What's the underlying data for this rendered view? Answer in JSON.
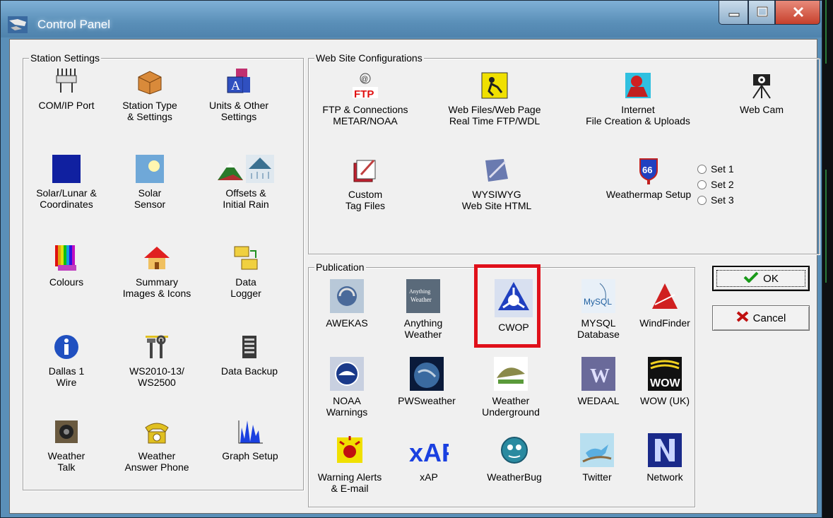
{
  "window": {
    "title": "Control Panel"
  },
  "station_settings": {
    "legend": "Station Settings",
    "items": [
      {
        "label": "COM/IP Port",
        "icon": "port-icon"
      },
      {
        "label": "Station Type\n& Settings",
        "icon": "box-icon"
      },
      {
        "label": "Units & Other\nSettings",
        "icon": "abc-blocks-icon"
      },
      {
        "label": "Solar/Lunar &\nCoordinates",
        "icon": "moon-icon"
      },
      {
        "label": "Solar\nSensor",
        "icon": "sun-icon"
      },
      {
        "label": "Offsets &\nInitial Rain",
        "icon": "mountain-rain-icon"
      },
      {
        "label": "Colours",
        "icon": "colours-icon"
      },
      {
        "label": "Summary\nImages & Icons",
        "icon": "house-icon"
      },
      {
        "label": "Data\nLogger",
        "icon": "folders-icon"
      },
      {
        "label": "Dallas 1\nWire",
        "icon": "info-icon"
      },
      {
        "label": "WS2010-13/\nWS2500",
        "icon": "tools-icon"
      },
      {
        "label": "Data Backup",
        "icon": "vise-icon"
      },
      {
        "label": "Weather\nTalk",
        "icon": "speaker-icon"
      },
      {
        "label": "Weather\nAnswer Phone",
        "icon": "phone-icon"
      },
      {
        "label": "Graph Setup",
        "icon": "graph-icon"
      }
    ]
  },
  "web_site": {
    "legend": "Web Site Configurations",
    "items": [
      {
        "label": "FTP & Connections\nMETAR/NOAA",
        "icon": "ftp-icon"
      },
      {
        "label": "Web Files/Web Page\nReal Time FTP/WDL",
        "icon": "worker-icon"
      },
      {
        "label": "Internet\nFile Creation & Uploads",
        "icon": "internet-icon"
      },
      {
        "label": "Web Cam",
        "icon": "webcam-icon"
      },
      {
        "label": "Custom\nTag Files",
        "icon": "tag-files-icon"
      },
      {
        "label": "WYSIWYG\nWeb Site HTML",
        "icon": "wysiwyg-icon"
      },
      {
        "label": "Weathermap Setup",
        "icon": "route-66-icon"
      }
    ],
    "radios": [
      "Set 1",
      "Set 2",
      "Set 3"
    ]
  },
  "publication": {
    "legend": "Publication",
    "items": [
      {
        "label": "AWEKAS",
        "icon": "awekas-icon"
      },
      {
        "label": "Anything\nWeather",
        "icon": "anything-weather-icon"
      },
      {
        "label": "CWOP",
        "icon": "cwop-icon"
      },
      {
        "label": "MYSQL\nDatabase",
        "icon": "mysql-icon"
      },
      {
        "label": "WindFinder",
        "icon": "windfinder-icon"
      },
      {
        "label": "NOAA\nWarnings",
        "icon": "noaa-icon"
      },
      {
        "label": "PWSweather",
        "icon": "pwsweather-icon"
      },
      {
        "label": "Weather\nUnderground",
        "icon": "wunderground-icon"
      },
      {
        "label": "WEDAAL",
        "icon": "wedaal-icon"
      },
      {
        "label": "WOW (UK)",
        "icon": "wow-icon"
      },
      {
        "label": "Warning Alerts\n& E-mail",
        "icon": "alert-icon"
      },
      {
        "label": "xAP",
        "icon": "xap-icon"
      },
      {
        "label": "WeatherBug",
        "icon": "weatherbug-icon"
      },
      {
        "label": "Twitter",
        "icon": "twitter-icon"
      },
      {
        "label": "Network",
        "icon": "network-icon"
      }
    ],
    "logo_text": {
      "ftp": "FTP",
      "xap": "xAP",
      "wow": "WOW",
      "route": "66",
      "anything": "Anything Weather",
      "mysql": "MySQL",
      "wedaal": "W"
    }
  },
  "buttons": {
    "ok": "OK",
    "cancel": "Cancel"
  }
}
